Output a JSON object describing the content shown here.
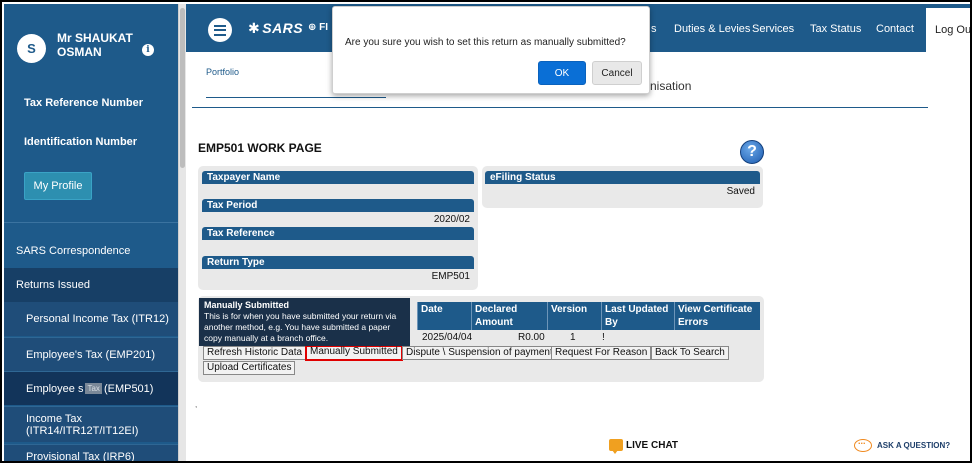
{
  "sidebar": {
    "user": {
      "initial": "S",
      "name": "Mr SHAUKAT OSMAN"
    },
    "tax_reference_label": "Tax Reference Number",
    "identification_label": "Identification Number",
    "profile_button": "My Profile",
    "items": [
      {
        "label": "SARS Correspondence"
      },
      {
        "label": "Returns Issued"
      },
      {
        "label": "Personal Income Tax (ITR12)"
      },
      {
        "label": "Employee's Tax (EMP201)"
      },
      {
        "label_prefix": "Employee s",
        "label_chip": "Tax",
        "label_suffix": "(EMP501)"
      },
      {
        "label": "Income Tax (ITR14/ITR12T/IT12EI)"
      },
      {
        "label": "Provisional Tax (IRP6)"
      }
    ]
  },
  "topnav": {
    "logo": "SARS",
    "logo2": "FI",
    "items": [
      "s",
      "Duties & Levies",
      "Services",
      "Tax Status",
      "Contact"
    ],
    "logout": "Log Ou"
  },
  "breadcrumb": {
    "portfolio": "Portfolio",
    "org_suffix": "nisation"
  },
  "dialog": {
    "message": "Are you sure you wish to set this return as manually submitted?",
    "ok": "OK",
    "cancel": "Cancel"
  },
  "work": {
    "title": "EMP501 WORK PAGE",
    "help_icon": "?",
    "fields": {
      "taxpayer_name_label": "Taxpayer Name",
      "taxpayer_name": "",
      "tax_period_label": "Tax Period",
      "tax_period": "2020/02",
      "tax_reference_label": "Tax Reference",
      "tax_reference": "",
      "return_type_label": "Return Type",
      "return_type": "EMP501",
      "efiling_status_label": "eFiling Status",
      "efiling_status": "Saved"
    },
    "table": {
      "headers": [
        "Date",
        "Declared Amount",
        "Version",
        "Last Updated By",
        "View Certificate Errors"
      ],
      "row": {
        "date": "2025/04/04",
        "amount": "R0.00",
        "version": "1",
        "updated_by": "!"
      }
    },
    "buttons": {
      "refresh": "Refresh Historic Data",
      "manually_submitted": "Manually Submitted",
      "dispute": "Dispute \\ Suspension of payment",
      "request_reason": "Request For Reason",
      "back_to_search": "Back To Search",
      "upload_certificates": "Upload Certificates"
    },
    "tooltip": {
      "title": "Manually Submitted",
      "body": "This is for when you have submitted your return via another method, e.g. You have submitted a paper copy manually at a branch office."
    },
    "tick": ","
  },
  "footer": {
    "live_chat": "LIVE CHAT",
    "ask_question": "ASK A QUESTION?"
  },
  "colors": {
    "primary": "#1e5a8a",
    "ok": "#0a6fd6",
    "highlight": "#e00000"
  }
}
